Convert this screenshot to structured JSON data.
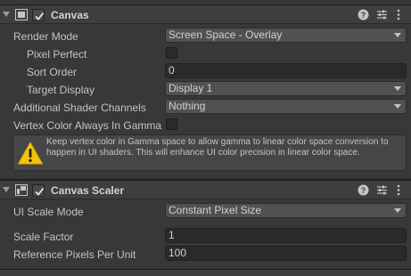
{
  "canvas": {
    "title": "Canvas",
    "enabled": true,
    "render_mode": {
      "label": "Render Mode",
      "value": "Screen Space - Overlay"
    },
    "pixel_perfect": {
      "label": "Pixel Perfect",
      "checked": false
    },
    "sort_order": {
      "label": "Sort Order",
      "value": "0"
    },
    "target_display": {
      "label": "Target Display",
      "value": "Display 1"
    },
    "additional_shader_channels": {
      "label": "Additional Shader Channels",
      "value": "Nothing"
    },
    "vertex_color_gamma": {
      "label": "Vertex Color Always In Gamma",
      "checked": false
    },
    "help_box": {
      "icon": "warning-icon",
      "text": "Keep vertex color in Gamma space to allow gamma to linear color space conversion to happen in UI shaders. This will enhance UI color precision in linear color space."
    }
  },
  "canvas_scaler": {
    "title": "Canvas Scaler",
    "enabled": true,
    "ui_scale_mode": {
      "label": "UI Scale Mode",
      "value": "Constant Pixel Size"
    },
    "scale_factor": {
      "label": "Scale Factor",
      "value": "1"
    },
    "reference_pixels_per_unit": {
      "label": "Reference Pixels Per Unit",
      "value": "100"
    }
  },
  "header_icons": [
    "help-icon",
    "preset-icon",
    "context-menu-icon"
  ],
  "colors": {
    "background": "#383838",
    "header": "#3e3e3e",
    "dropdown": "#515151",
    "field": "#2a2a2a",
    "warning": "#f4c20d"
  }
}
